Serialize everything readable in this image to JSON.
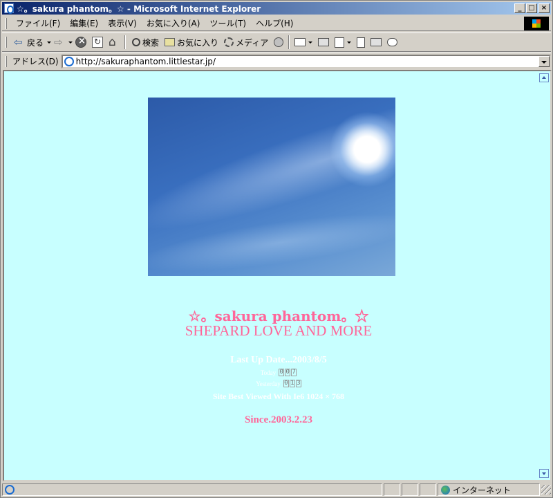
{
  "window": {
    "title": "☆。sakura phantom。☆ - Microsoft Internet Explorer",
    "minimize": "_",
    "maximize": "□",
    "close": "×"
  },
  "menu": {
    "items": [
      "ファイル(F)",
      "編集(E)",
      "表示(V)",
      "お気に入り(A)",
      "ツール(T)",
      "ヘルプ(H)"
    ]
  },
  "toolbar": {
    "back_label": "戻る",
    "search_label": "検索",
    "favorites_label": "お気に入り",
    "media_label": "メディア"
  },
  "address": {
    "label": "アドレス(D)",
    "url": "http://sakuraphantom.littlestar.jp/"
  },
  "page": {
    "title_line1": "☆。sakura phantom。☆",
    "title_line2": "SHEPARD LOVE AND MORE",
    "last_update": "Last Up Date...2003/8/5",
    "today_label": "Today",
    "today_digits": [
      "0",
      "0",
      "7"
    ],
    "yesterday_label": "Yesterday",
    "yesterday_digits": [
      "0",
      "1",
      "3"
    ],
    "best_viewed": "Site Best Viewed With Ie6 1024 × 768",
    "since": "Since.2003.2.23",
    "accent_color": "#ff6699",
    "background_color": "#c8ffff"
  },
  "status": {
    "zone": "インターネット"
  }
}
